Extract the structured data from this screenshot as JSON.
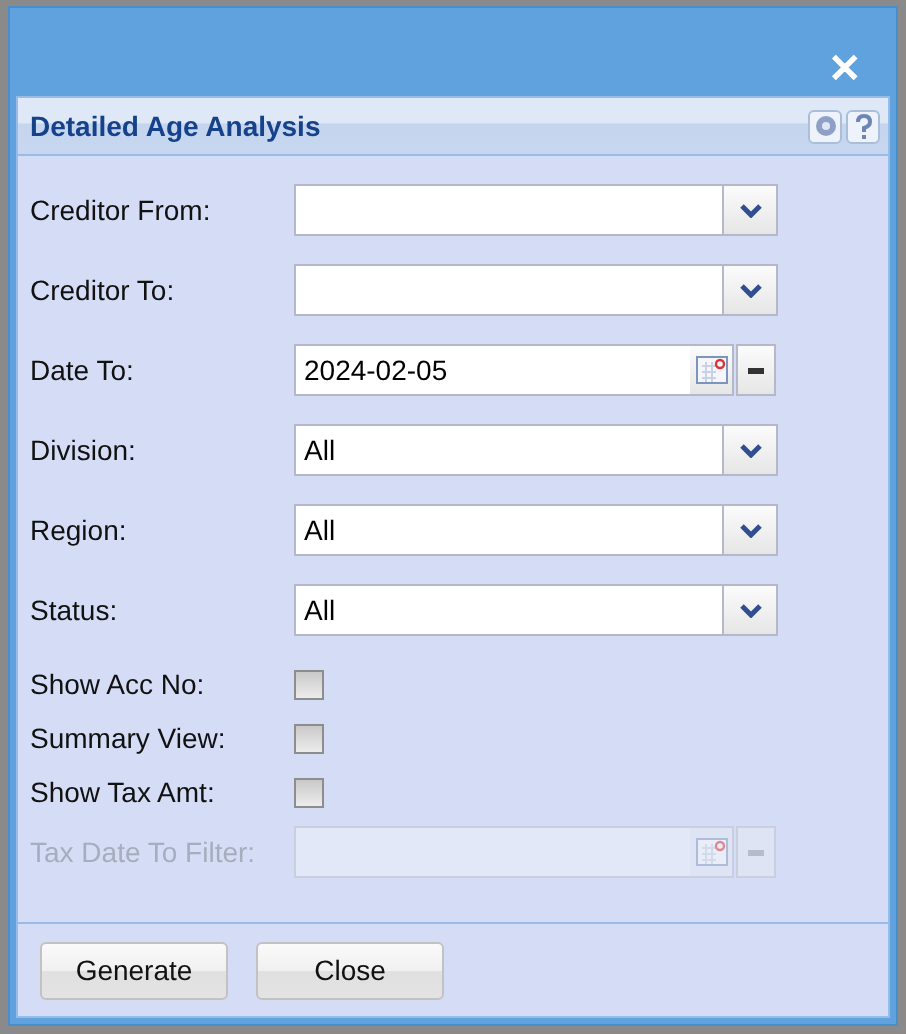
{
  "window": {
    "close": "✕"
  },
  "panel": {
    "title": "Detailed Age Analysis"
  },
  "fields": [
    {
      "kind": "combo",
      "label": "Creditor From:",
      "disabled": false
    },
    {
      "kind": "combo",
      "label": "Creditor To:",
      "disabled": false
    },
    {
      "kind": "date",
      "label": "Date To:",
      "value": "2024-02-05",
      "disabled": false
    },
    {
      "kind": "combo",
      "label": "Division:",
      "value": "All",
      "disabled": false
    },
    {
      "kind": "combo",
      "label": "Region:",
      "value": "All",
      "disabled": false
    },
    {
      "kind": "combo",
      "label": "Status:",
      "value": "All",
      "disabled": false
    },
    {
      "kind": "checkbox",
      "label": "Show Acc No:",
      "checked": false
    },
    {
      "kind": "checkbox",
      "label": "Summary View:",
      "checked": false
    },
    {
      "kind": "checkbox",
      "label": "Show Tax Amt:",
      "checked": false
    },
    {
      "kind": "date",
      "label": "Tax Date To Filter:",
      "disabled": true
    }
  ],
  "buttons": [
    "Generate",
    "Close"
  ]
}
